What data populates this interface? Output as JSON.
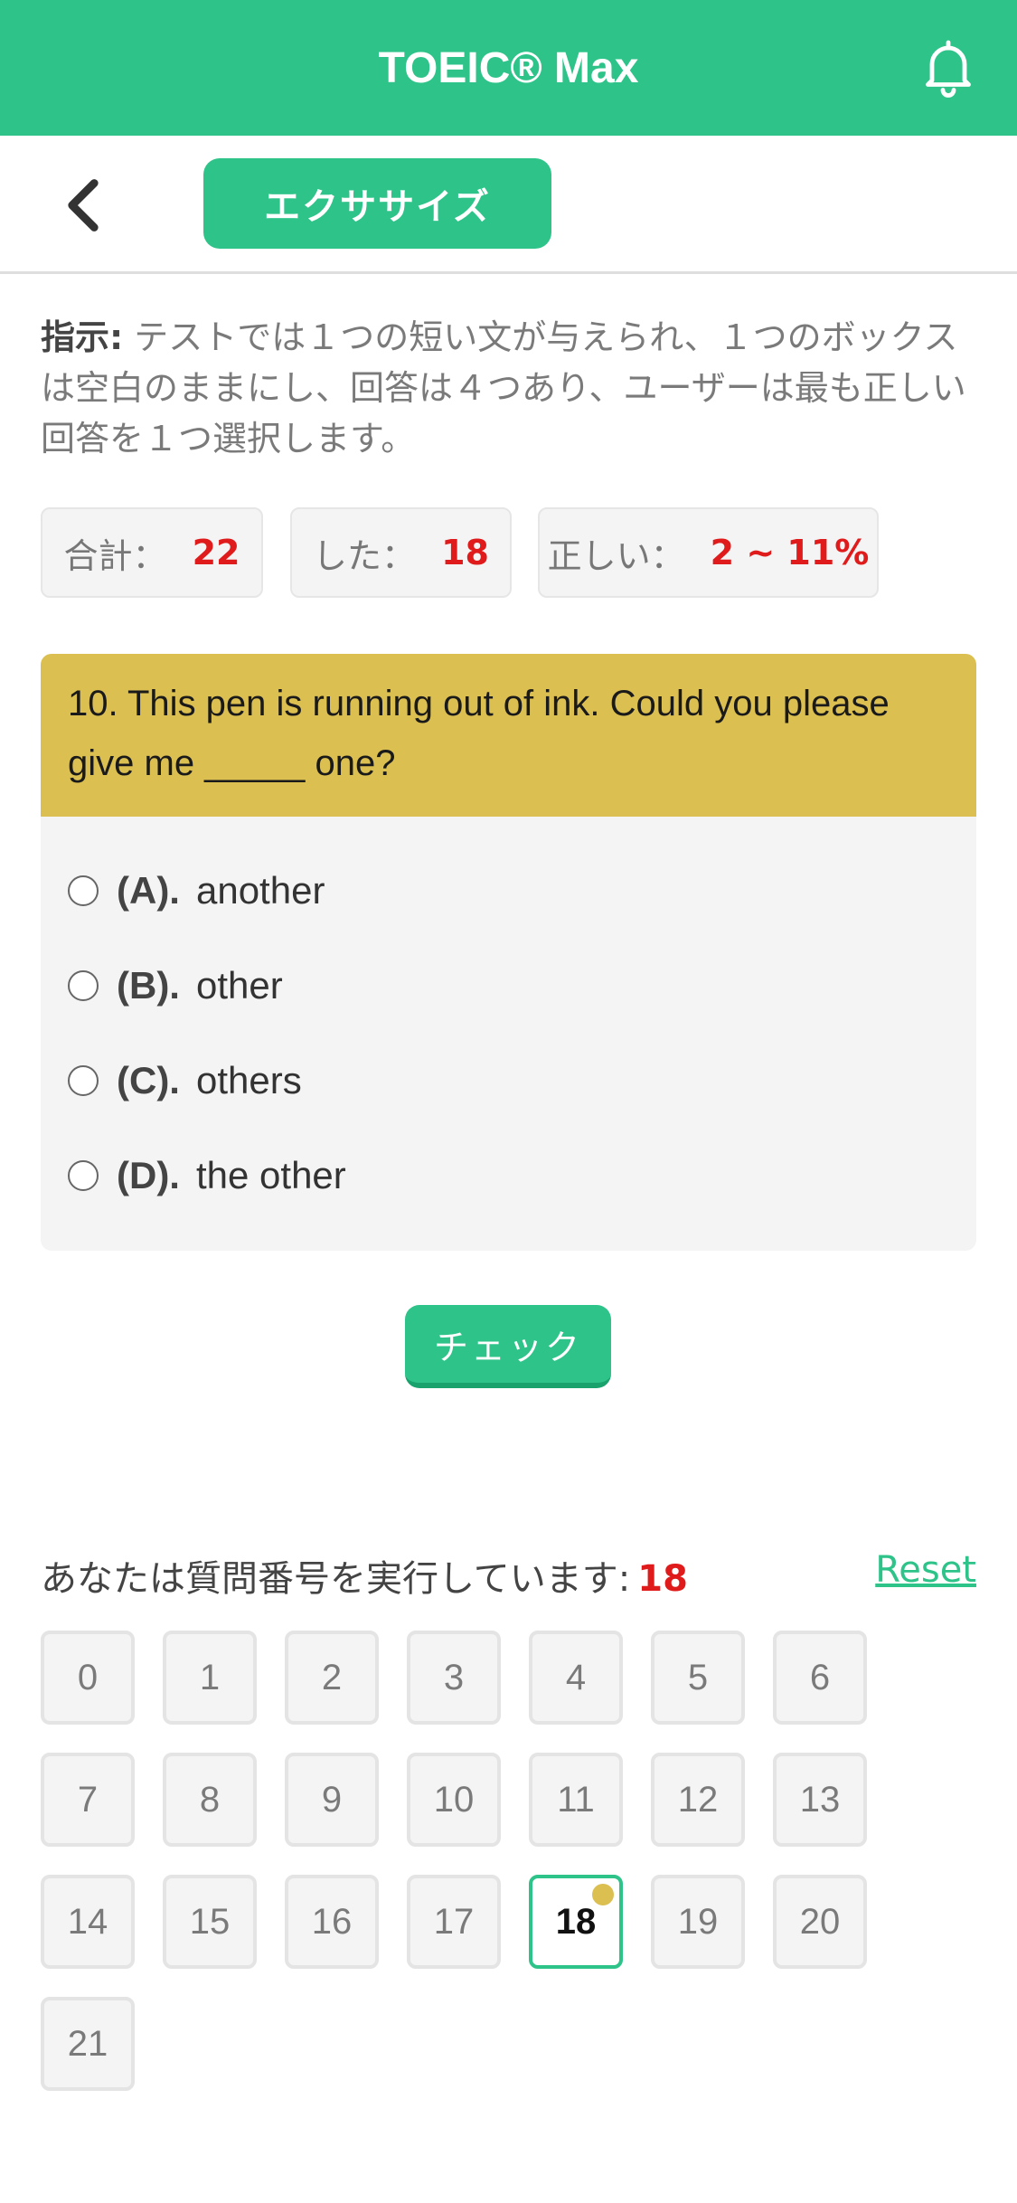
{
  "app": {
    "title": "TOEIC® Max"
  },
  "subheader": {
    "tab_label": "エクササイズ"
  },
  "instruction": {
    "label": "指示:",
    "text": " テストでは１つの短い文が与えられ、１つのボックスは空白のままにし、回答は４つあり、ユーザーは最も正しい回答を１つ選択します。"
  },
  "stats": {
    "total_label": "合計：",
    "total_value": "22",
    "done_label": "した：",
    "done_value": "18",
    "correct_label": "正しい：",
    "correct_value": "2 ~ 11%"
  },
  "question": {
    "text": "10. This pen is running out of ink. Could you please give me _____ one?",
    "options": [
      {
        "letter": "(A).",
        "text": "another"
      },
      {
        "letter": "(B).",
        "text": "other"
      },
      {
        "letter": "(C).",
        "text": "others"
      },
      {
        "letter": "(D).",
        "text": "the other"
      }
    ]
  },
  "check_label": "チェック",
  "progress": {
    "label": "あなたは質問番号を実行しています:",
    "current": "18",
    "reset_label": "Reset",
    "numbers": [
      "0",
      "1",
      "2",
      "3",
      "4",
      "5",
      "6",
      "7",
      "8",
      "9",
      "10",
      "11",
      "12",
      "13",
      "14",
      "15",
      "16",
      "17",
      "18",
      "19",
      "20",
      "21"
    ],
    "current_index": 18
  },
  "colors": {
    "brand": "#2dc389",
    "question_header": "#dbbf51",
    "highlight": "#e01b1b"
  },
  "icons": {
    "bell": "bell-icon",
    "back": "chevron-left-icon"
  }
}
